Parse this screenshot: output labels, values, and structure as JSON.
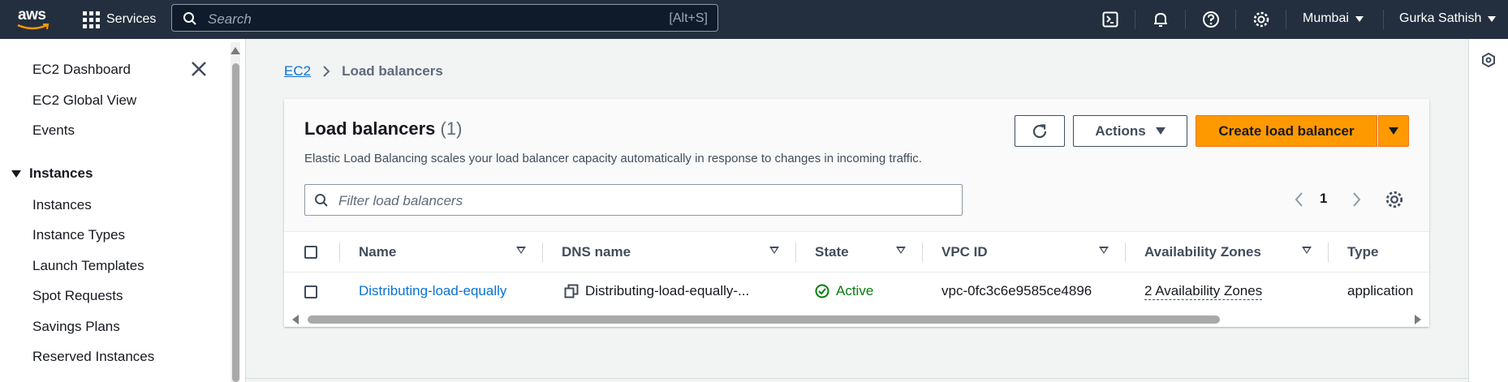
{
  "topnav": {
    "logo_text": "aws",
    "services_label": "Services",
    "search_placeholder": "Search",
    "search_shortcut": "[Alt+S]",
    "icons": [
      "cloudshell-icon",
      "notifications-icon",
      "help-icon",
      "settings-icon"
    ],
    "region": "Mumbai",
    "user": "Gurka Sathish"
  },
  "sidebar": {
    "items": [
      "EC2 Dashboard",
      "EC2 Global View",
      "Events"
    ],
    "section": "Instances",
    "section_items": [
      "Instances",
      "Instance Types",
      "Launch Templates",
      "Spot Requests",
      "Savings Plans",
      "Reserved Instances"
    ]
  },
  "breadcrumb": {
    "root": "EC2",
    "current": "Load balancers"
  },
  "panel": {
    "title": "Load balancers",
    "count": "(1)",
    "description": "Elastic Load Balancing scales your load balancer capacity automatically in response to changes in incoming traffic.",
    "actions_label": "Actions",
    "create_label": "Create load balancer",
    "filter_placeholder": "Filter load balancers",
    "page": "1"
  },
  "table": {
    "columns": [
      "Name",
      "DNS name",
      "State",
      "VPC ID",
      "Availability Zones",
      "Type"
    ],
    "rows": [
      {
        "name": "Distributing-load-equally",
        "dns": "Distributing-load-equally-...",
        "state": "Active",
        "vpc": "vpc-0fc3c6e9585ce4896",
        "azs": "2 Availability Zones",
        "type": "application"
      }
    ]
  },
  "colors": {
    "topnav_bg": "#232f3e",
    "primary": "#ff9900",
    "link": "#0972d3",
    "active": "#037f0c"
  }
}
